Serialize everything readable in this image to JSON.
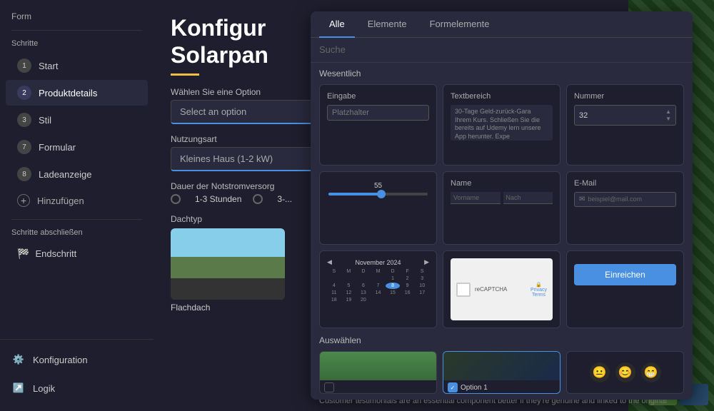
{
  "sidebar": {
    "form_label": "Form",
    "steps_label": "Schritte",
    "steps": [
      {
        "num": "1",
        "label": "Start"
      },
      {
        "num": "2",
        "label": "Produktdetails"
      },
      {
        "num": "3",
        "label": "Stil"
      },
      {
        "num": "7",
        "label": "Formular"
      },
      {
        "num": "8",
        "label": "Ladeanzeige"
      }
    ],
    "add_label": "Hinzufügen",
    "close_label": "Schritte abschließen",
    "end_label": "Endschritt",
    "bottom": [
      {
        "icon": "gear",
        "label": "Konfiguration"
      },
      {
        "icon": "logic",
        "label": "Logik"
      }
    ]
  },
  "main": {
    "title_line1": "Konfigur",
    "title_line2": "Solarpan",
    "field1_label": "Wählen Sie eine Option",
    "field1_placeholder": "Select an option",
    "field2_label": "Nutzungsart",
    "field2_value": "Kleines Haus (1-2 kW)",
    "field3_label": "Dauer der Notstromversorg",
    "radio1": "1-3 Stunden",
    "radio2": "3-...",
    "dachtyp_label": "Dachtyp",
    "dachtyp_caption": "Flachdach"
  },
  "panel": {
    "tabs": [
      "Alle",
      "Elemente",
      "Formelemente"
    ],
    "active_tab": "Alle",
    "search_placeholder": "Suche",
    "section1_label": "Wesentlich",
    "items": [
      {
        "id": "eingabe",
        "label": "Eingabe",
        "placeholder": "Platzhalter"
      },
      {
        "id": "textbereich",
        "label": "Textbereich",
        "text": "30-Tage Geld-zurück-Gara Ihrem Kurs. Schließen Sie die bereits auf Udemy lern unsere App herunter. Expe"
      },
      {
        "id": "nummer",
        "label": "Nummer",
        "value": "32"
      },
      {
        "id": "slider",
        "label": "",
        "value": "55"
      },
      {
        "id": "name",
        "label": "Name",
        "first": "Vorname",
        "last": "Nach"
      },
      {
        "id": "email",
        "label": "E-Mail",
        "placeholder": "beispiel@mail.com"
      },
      {
        "id": "calendar",
        "label": "",
        "month": "November 2024"
      },
      {
        "id": "recaptcha",
        "label": "",
        "text": "reCAPTCHA Privacy Terms"
      },
      {
        "id": "einreichen",
        "label": "",
        "btn_label": "Einreichen"
      }
    ],
    "section2_label": "Auswählen",
    "selection_items": [
      {
        "id": "sky",
        "label": "",
        "selected": false
      },
      {
        "id": "option1",
        "label": "Option 1",
        "selected": true
      },
      {
        "id": "emoji",
        "label": ""
      }
    ],
    "emojis": [
      "😐",
      "😊",
      "😁"
    ]
  },
  "bottom_text": "Customer testimonials are an essential component better if they're genuine and linked to the original"
}
